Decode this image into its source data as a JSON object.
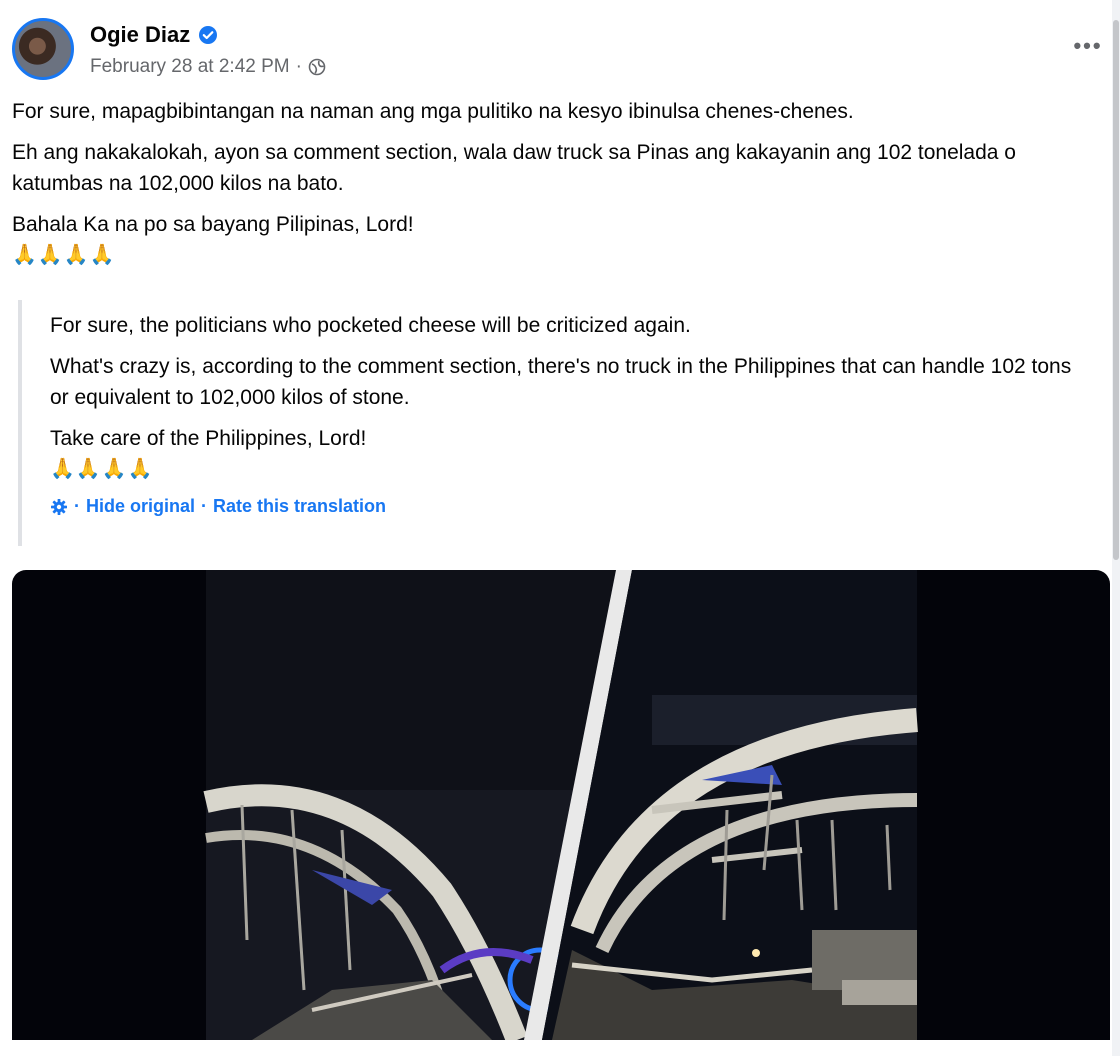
{
  "post": {
    "author": "Ogie Diaz",
    "timestamp": "February 28 at 2:42 PM",
    "separator": "·",
    "more_label": "•••",
    "paragraphs": [
      "For sure, mapagbibintangan na naman ang mga pulitiko na kesyo ibinulsa chenes-chenes.",
      "Eh ang nakakalokah, ayon sa comment section, wala daw truck sa Pinas ang kakayanin ang 102 tonelada o katumbas na 102,000  kilos na bato.",
      "Bahala Ka na po sa bayang Pilipinas, Lord!"
    ],
    "emojis": "🙏🙏🙏🙏"
  },
  "translation": {
    "paragraphs": [
      "For sure, the politicians who pocketed cheese will be criticized again.",
      "What's crazy is, according to the comment section, there's no truck in the Philippines that can handle 102 tons or equivalent to 102,000 kilos of stone.",
      "Take care of the Philippines, Lord!"
    ],
    "emojis": "🙏🙏🙏🙏",
    "hide_original": "Hide original",
    "rate_translation": "Rate this translation",
    "separator": "·"
  },
  "icons": {
    "verified": "verified-badge-icon",
    "globe": "globe-icon",
    "gear": "gear-icon",
    "more": "more-horizontal-icon"
  },
  "colors": {
    "accent": "#1877f2",
    "secondary_text": "#65676b",
    "media_background": "#03040a"
  }
}
